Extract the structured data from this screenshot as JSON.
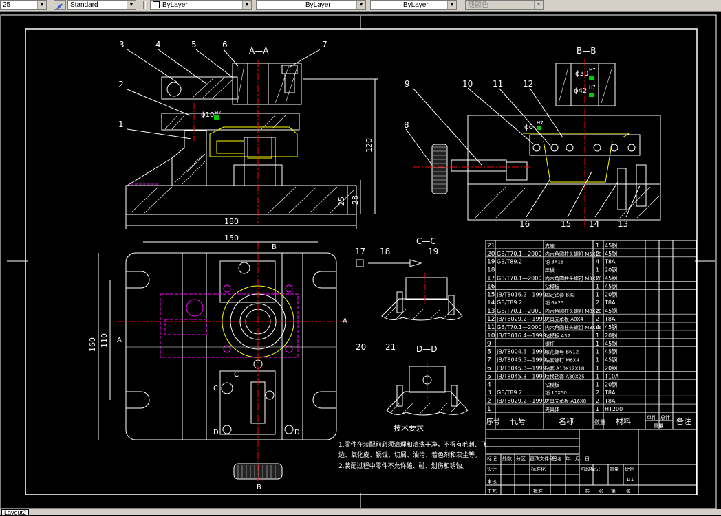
{
  "toolbar": {
    "scale_value": "25",
    "text_style": "Standard",
    "layer_color": "ByLayer",
    "linetype": "ByLayer",
    "lineweight": "ByLayer",
    "plot_style": "随颜色"
  },
  "layout_tab": "Layout2",
  "drawing": {
    "views": {
      "section_aa": "A—A",
      "section_bb": "B—B",
      "section_cc": "C—C",
      "section_dd": "D—D"
    },
    "dimensions": {
      "width_180": "180",
      "width_150": "150",
      "height_120": "120",
      "height_25": "25",
      "height_28": "28",
      "height_160": "160",
      "height_110": "110",
      "bore_10": "ϕ10",
      "bore_6": "ϕ6",
      "bore_30": "ϕ30",
      "bore_42": "ϕ42",
      "fit_h7": "H7",
      "fit_g6": "g6",
      "fit_k6": "k6"
    },
    "balloons": [
      "1",
      "2",
      "3",
      "4",
      "5",
      "6",
      "7",
      "8",
      "9",
      "10",
      "11",
      "12",
      "13",
      "14",
      "15",
      "16",
      "17",
      "18",
      "19",
      "20",
      "21"
    ],
    "view_markers": {
      "a": "A",
      "b": "B",
      "c": "C",
      "d": "D"
    },
    "tech_title": "技术要求",
    "tech_notes": [
      "1.零件在装配前必须清理和清洗干净，不得有毛刺、飞",
      "边、氧化皮、锈蚀、切屑、油污、着色剂和灰尘等。",
      "2.装配过程中零件不允许磕、碰、划伤和锈蚀。"
    ]
  },
  "bom": {
    "rows": [
      {
        "no": "21",
        "code": "",
        "name": "支座",
        "qty": "1",
        "material": "45钢"
      },
      {
        "no": "20",
        "code": "GB/T70.1—2000",
        "name": "内六角圆柱头螺钉 M5X10",
        "qty": "2",
        "material": "45钢"
      },
      {
        "no": "19",
        "code": "GB/T89.2",
        "name": "销 3X15",
        "qty": "4",
        "material": "T8A"
      },
      {
        "no": "18",
        "code": "",
        "name": "压板",
        "qty": "1",
        "material": "20钢"
      },
      {
        "no": "17",
        "code": "GB/T70.1—2000",
        "name": "内六角圆柱头螺钉 M3X16",
        "qty": "2",
        "material": "45钢"
      },
      {
        "no": "16",
        "code": "",
        "name": "钻模板",
        "qty": "1",
        "material": "45钢"
      },
      {
        "no": "15",
        "code": "JB/T8016.2—1999",
        "name": "固定钻套 B32",
        "qty": "1",
        "material": "20钢"
      },
      {
        "no": "14",
        "code": "GB/T89.2",
        "name": "销 6X25",
        "qty": "2",
        "material": "T8A"
      },
      {
        "no": "13",
        "code": "GB/T70.1—2000",
        "name": "内六角圆柱头螺钉 M8X20",
        "qty": "2",
        "material": "45钢"
      },
      {
        "no": "12",
        "code": "JB/T8029.2—1999",
        "name": "夹具支承板 A8X4",
        "qty": "2",
        "material": "T8A"
      },
      {
        "no": "11",
        "code": "GB/T70.1—2000",
        "name": "内六角圆柱头螺钉 M3X16",
        "qty": "4",
        "material": "45钢"
      },
      {
        "no": "10",
        "code": "JB/T8016.4—1999",
        "name": "钻模板 A32",
        "qty": "1",
        "material": "20钢"
      },
      {
        "no": "9",
        "code": "",
        "name": "螺杆",
        "qty": "1",
        "material": "45钢"
      },
      {
        "no": "8",
        "code": "JB/T8004.5—1999",
        "name": "滚花螺母 BN12",
        "qty": "1",
        "material": "45钢"
      },
      {
        "no": "7",
        "code": "JB/T8045.5—1999",
        "name": "钻套螺钉 M6X4",
        "qty": "1",
        "material": "45钢"
      },
      {
        "no": "6",
        "code": "JB/T8045.3—1999",
        "name": "钻套 A10X12X18",
        "qty": "1",
        "material": "20钢"
      },
      {
        "no": "5",
        "code": "JB/T8045.3—1999",
        "name": "快换钻套 A30X25",
        "qty": "1",
        "material": "T10A"
      },
      {
        "no": "4",
        "code": "",
        "name": "钻模板",
        "qty": "1",
        "material": "20钢"
      },
      {
        "no": "3",
        "code": "GB/T89.2",
        "name": "销 10X50",
        "qty": "2",
        "material": "T8A"
      },
      {
        "no": "2",
        "code": "JB/T8029.2—1999",
        "name": "夹具支承板 A16X8",
        "qty": "2",
        "material": "T8A"
      },
      {
        "no": "1",
        "code": "",
        "name": "夹具体",
        "qty": "1",
        "material": "HT200"
      }
    ],
    "header": {
      "no": "序号",
      "code": "代号",
      "name": "名称",
      "qty": "数量",
      "material": "材料",
      "single": "单件",
      "total": "总计",
      "weight": "重量",
      "remark": "备注"
    }
  },
  "title_block": {
    "row1": [
      "标记",
      "处数",
      "分区",
      "更改文件号",
      "签名",
      "年、月、日"
    ],
    "design": "设计",
    "standard": "标准化",
    "stage": "阶段标记",
    "weight": "重量",
    "scale": "比例",
    "scale_value": "1:1",
    "review": "审核",
    "craft": "工艺",
    "approve": "批准",
    "sheets": [
      "共",
      "张",
      "第",
      "张"
    ]
  }
}
